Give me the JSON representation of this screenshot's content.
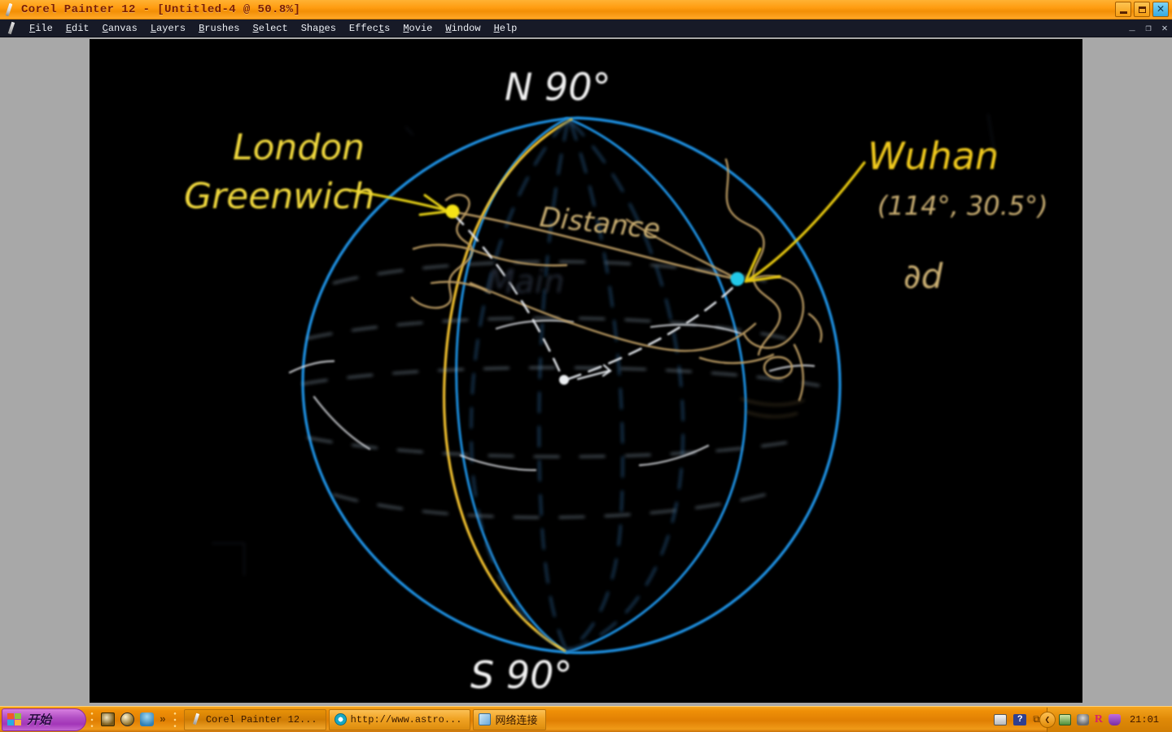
{
  "window": {
    "title": "Corel Painter 12 - [Untitled-4 @ 50.8%]",
    "app_icon": "paintbrush-icon",
    "controls": {
      "minimize": "minimize-icon",
      "restore": "restore-icon",
      "close": "close-icon"
    },
    "document_controls": {
      "minimize": "_",
      "restore": "❐",
      "close": "✕"
    }
  },
  "menubar": {
    "icon": "paintbrush-icon",
    "items": [
      {
        "label": "File",
        "accel": "F"
      },
      {
        "label": "Edit",
        "accel": "E"
      },
      {
        "label": "Canvas",
        "accel": "C"
      },
      {
        "label": "Layers",
        "accel": "L"
      },
      {
        "label": "Brushes",
        "accel": "B"
      },
      {
        "label": "Select",
        "accel": "S"
      },
      {
        "label": "Shapes",
        "accel": "p"
      },
      {
        "label": "Effects",
        "accel": "t"
      },
      {
        "label": "Movie",
        "accel": "M"
      },
      {
        "label": "Window",
        "accel": "W"
      },
      {
        "label": "Help",
        "accel": "H"
      }
    ]
  },
  "canvas": {
    "background_color": "#000000",
    "annotations": {
      "north_pole": "N 90°",
      "south_pole": "S 90°",
      "london": "London",
      "greenwich": "Greenwich",
      "wuhan": "Wuhan",
      "wuhan_coords": "(114°, 30.5°)",
      "partial_d": "∂d",
      "distance": "Distance",
      "faint_word": "Main"
    },
    "colors": {
      "globe_outline": "#1f8fe0",
      "prime_meridian": "#f2c12e",
      "london_dot": "#f5e317",
      "wuhan_dot": "#22c8e8",
      "coastline": "#b99a62",
      "label_white": "#f2f2f2",
      "label_yellow": "#f0d83c",
      "label_tan": "#c9ae72",
      "guides": "#d8d8d8"
    }
  },
  "taskbar": {
    "start_label": "开始",
    "quicklaunch": [
      {
        "name": "quicklaunch-icon-1"
      },
      {
        "name": "quicklaunch-icon-2"
      },
      {
        "name": "quicklaunch-icon-3"
      }
    ],
    "quicklaunch_more": "»",
    "tasks": [
      {
        "label": "Corel Painter 12...",
        "icon": "painter-icon",
        "active": true
      },
      {
        "label": "http://www.astro...",
        "icon": "opera-icon",
        "active": false
      },
      {
        "label": "网络连接",
        "icon": "network-icon",
        "active": false
      }
    ],
    "tray": {
      "icons": [
        {
          "name": "keyboard-layout-icon"
        },
        {
          "name": "help-icon"
        },
        {
          "name": "window-icon"
        },
        {
          "name": "show-hidden-icons-chevron"
        },
        {
          "name": "display-icon"
        },
        {
          "name": "messenger-icon"
        },
        {
          "name": "realplayer-icon"
        },
        {
          "name": "security-shield-icon"
        }
      ],
      "chevron": "❮",
      "clock": "21:01"
    }
  }
}
